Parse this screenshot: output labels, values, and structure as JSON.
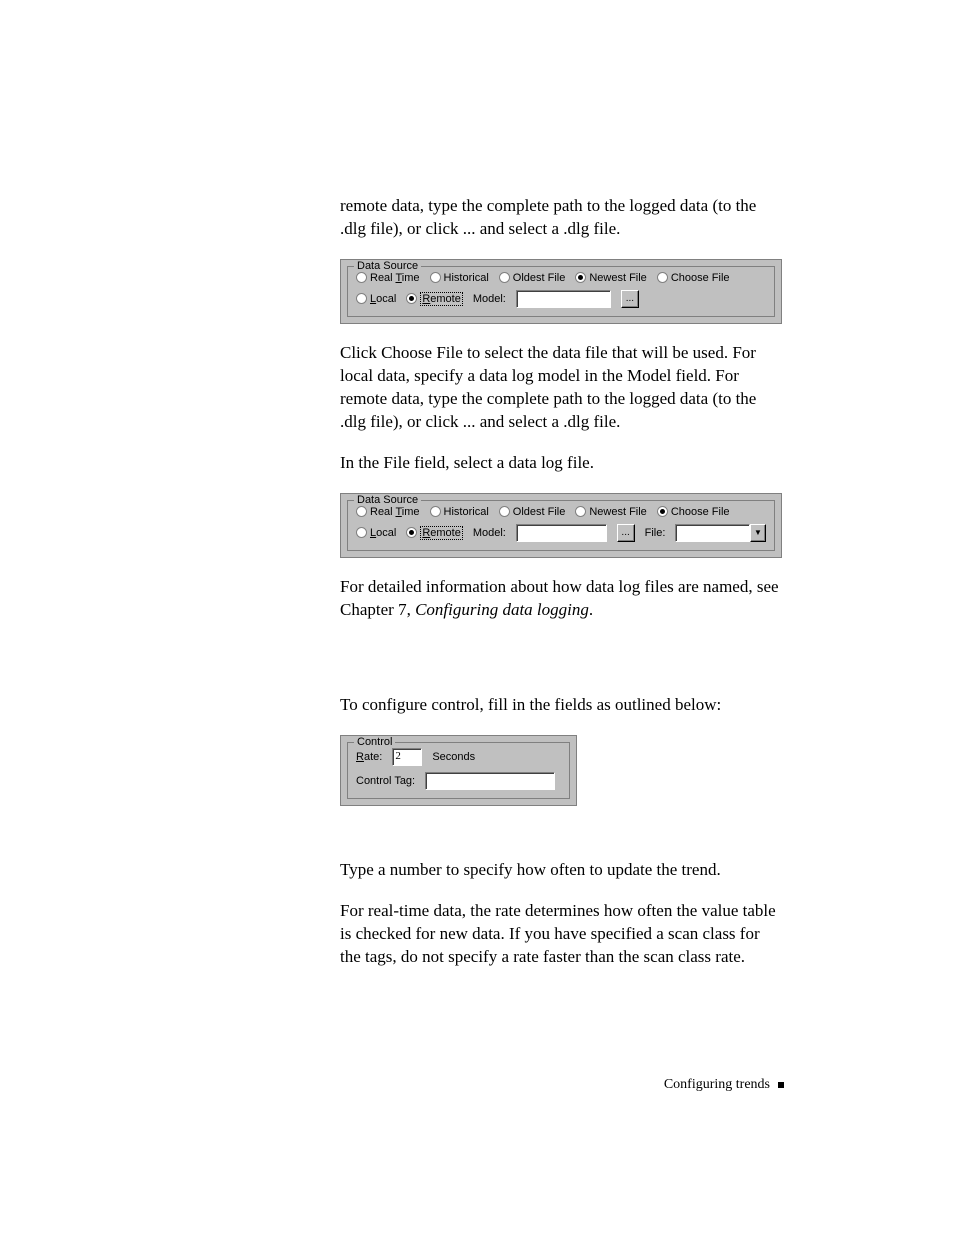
{
  "para1": "remote data, type the complete path to the logged data (to the .dlg file), or click ... and select a .dlg file.",
  "ds1": {
    "legend": "Data Source",
    "radios": {
      "realtime": "Real Time",
      "historical": "Historical",
      "oldest": "Oldest File",
      "newest": "Newest File",
      "choose": "Choose File",
      "local": "Local",
      "remote": "Remote"
    },
    "model_label": "Model:",
    "browse": "..."
  },
  "para2": "Click Choose File to select the data file that will be used. For local data, specify a data log model in the Model field. For remote data, type the complete path to the logged data (to the .dlg file), or click ... and select a .dlg file.",
  "para3": "In the File field, select a data log file.",
  "ds2": {
    "file_label": "File:"
  },
  "para4_a": "For detailed information about how data log files are named, see Chapter 7, ",
  "para4_b": "Configuring data logging",
  "para4_c": ".",
  "para5": "To configure control, fill in the fields as outlined below:",
  "control": {
    "legend": "Control",
    "rate_label": "Rate:",
    "rate_value": "2",
    "seconds": "Seconds",
    "tag_label": "Control Tag:"
  },
  "para6": "Type a number to specify how often to update the trend.",
  "para7": "For real-time data, the rate determines how often the value table is checked for new data. If you have specified a scan class for the tags, do not specify a rate faster than the scan class rate.",
  "footer": "Configuring trends"
}
